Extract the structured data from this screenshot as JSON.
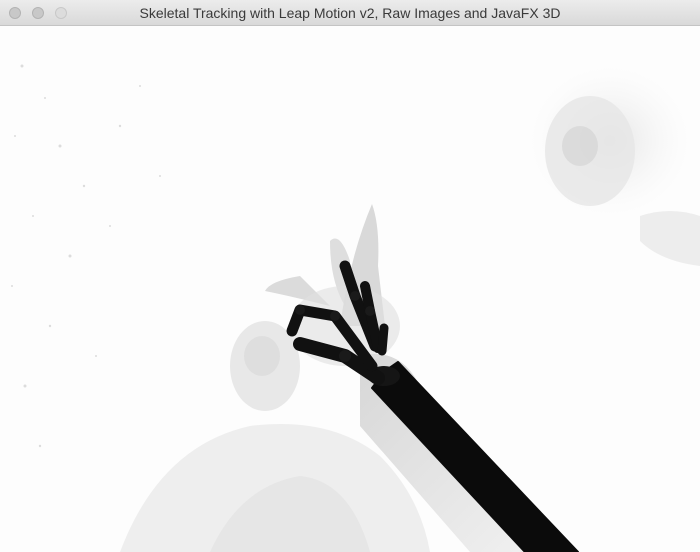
{
  "window": {
    "title": "Skeletal Tracking with Leap Motion v2, Raw Images and JavaFX 3D",
    "controls": [
      "close",
      "minimize",
      "zoom"
    ]
  },
  "scene": {
    "background_color": "#fdfdfd",
    "bone_color": "#111111",
    "raw_image_tint": "#d8d8d8"
  }
}
